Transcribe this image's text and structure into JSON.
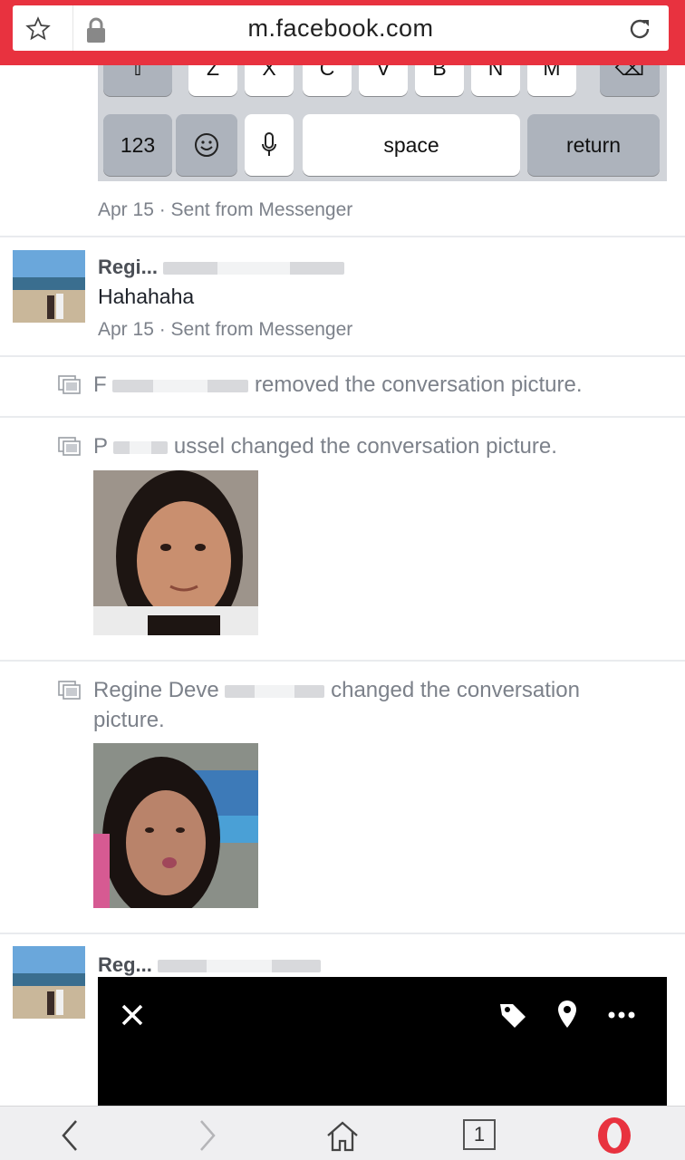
{
  "browser": {
    "url": "m.facebook.com",
    "tab_count": "1",
    "accent_color": "#e8323f"
  },
  "keyboard": {
    "top_row": [
      "Z",
      "X",
      "C",
      "V",
      "B",
      "N",
      "M"
    ],
    "numbers_key": "123",
    "space_key": "space",
    "return_key": "return"
  },
  "conversation": {
    "message1": {
      "meta": "Apr 15 · Sent from Messenger"
    },
    "message2": {
      "sender": "Regi...",
      "text": "Hahahaha",
      "meta": "Apr 15 · Sent from Messenger"
    },
    "event1": {
      "actor_prefix": "F",
      "text": " removed the conversation picture."
    },
    "event2": {
      "actor_prefix": "P",
      "actor_visible": "ussel",
      "text": " changed the conversation picture."
    },
    "event3": {
      "actor_prefix": "Regine Deve",
      "text": "changed the conversation",
      "text_line2": "picture."
    },
    "message3": {
      "sender": "Reg..."
    }
  },
  "overlay_toolbar": {
    "icons": [
      "close-icon",
      "tag-icon",
      "location-pin-icon",
      "more-icon"
    ]
  },
  "bottom_nav": {
    "icons": [
      "back-icon",
      "forward-icon",
      "home-icon",
      "tabs-icon",
      "opera-menu-icon"
    ]
  }
}
